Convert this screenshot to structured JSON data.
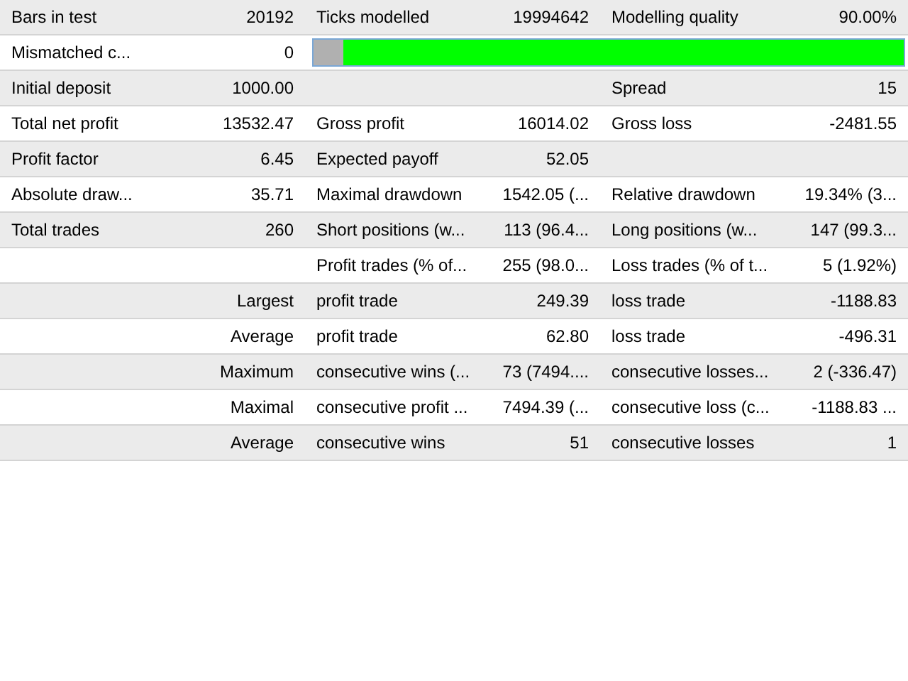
{
  "rows": [
    {
      "cells": [
        "Bars in test",
        "20192",
        "Ticks modelled",
        "19994642",
        "Modelling quality",
        "90.00%"
      ]
    },
    {
      "cells": [
        "Mismatched c...",
        "0"
      ],
      "bar": {
        "level": 0.95
      }
    },
    {
      "cells": [
        "Initial deposit",
        "1000.00",
        null,
        null,
        "Spread",
        "15"
      ]
    },
    {
      "cells": [
        "Total net profit",
        "13532.47",
        "Gross profit",
        "16014.02",
        "Gross loss",
        "-2481.55"
      ]
    },
    {
      "cells": [
        "Profit factor",
        "6.45",
        "Expected payoff",
        "52.05",
        null,
        null
      ]
    },
    {
      "cells": [
        "Absolute draw...",
        "35.71",
        "Maximal drawdown",
        "1542.05 (...",
        "Relative drawdown",
        "19.34% (3..."
      ]
    },
    {
      "cells": [
        "Total trades",
        "260",
        "Short positions (w...",
        "113 (96.4...",
        "Long positions (w...",
        "147 (99.3..."
      ]
    },
    {
      "cells": [
        null,
        null,
        "Profit trades (% of...",
        "255 (98.0...",
        "Loss trades (% of t...",
        "5 (1.92%)"
      ]
    },
    {
      "cells": [
        null,
        "Largest",
        "profit trade",
        "249.39",
        "loss trade",
        "-1188.83"
      ]
    },
    {
      "cells": [
        null,
        "Average",
        "profit trade",
        "62.80",
        "loss trade",
        "-496.31"
      ]
    },
    {
      "cells": [
        null,
        "Maximum",
        "consecutive wins (...",
        "73 (7494....",
        "consecutive losses...",
        "2 (-336.47)"
      ]
    },
    {
      "cells": [
        null,
        "Maximal",
        "consecutive profit ...",
        "7494.39 (...",
        "consecutive loss (c...",
        "-1188.83 ..."
      ]
    },
    {
      "cells": [
        null,
        "Average",
        "consecutive wins",
        "51",
        "consecutive losses",
        "1"
      ]
    }
  ]
}
